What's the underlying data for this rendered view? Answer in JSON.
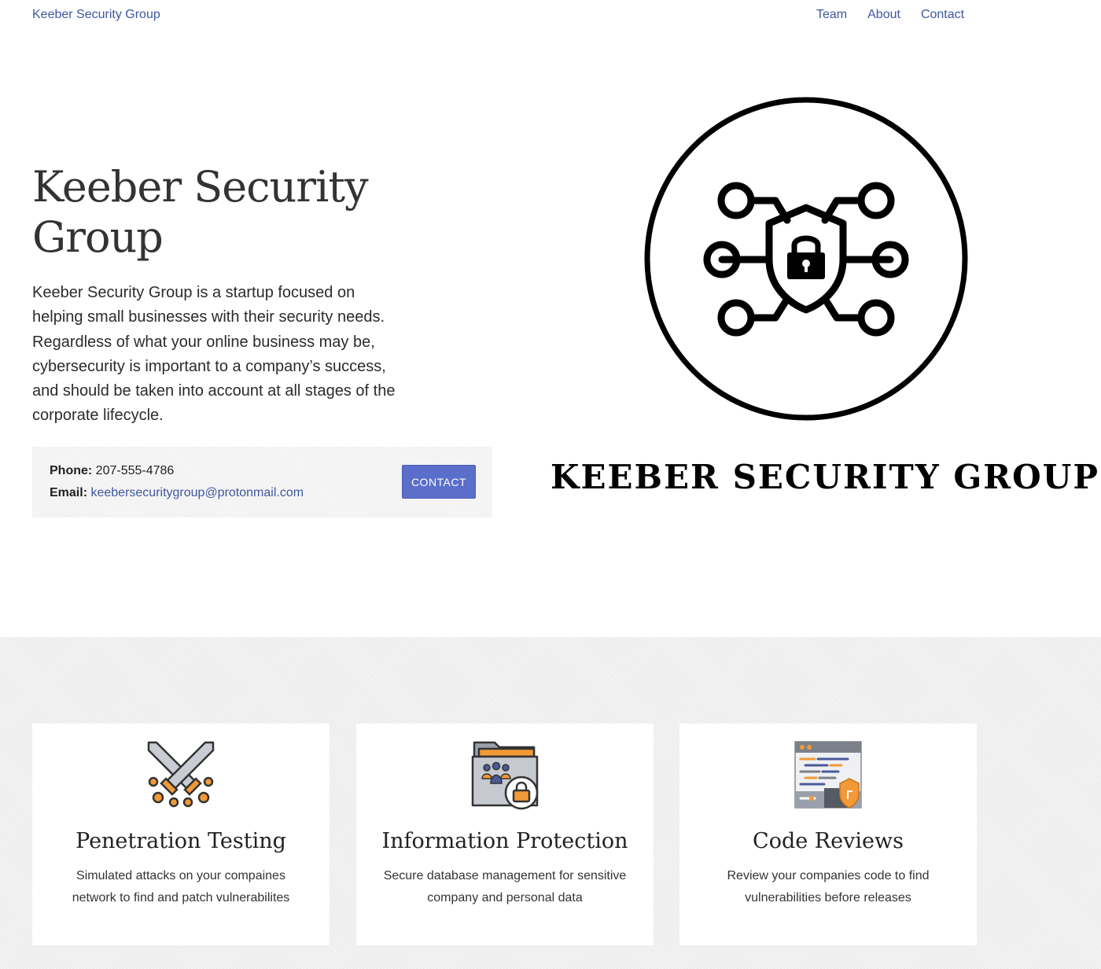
{
  "nav": {
    "brand": "Keeber Security Group",
    "links": [
      "Team",
      "About",
      "Contact"
    ]
  },
  "hero": {
    "title": "Keeber Security Group",
    "description": "Keeber Security Group is a startup focused on helping small businesses with their security needs. Regardless of what your online business may be, cybersecurity is important to a company’s success, and should be taken into account at all stages of the corporate lifecycle.",
    "phone_label": "Phone:",
    "phone": "207-555-4786",
    "email_label": "Email:",
    "email": "keebersecuritygroup@protonmail.com",
    "contact_button": "CONTACT",
    "logo_wordmark": "KEEBER SECURITY GROUP"
  },
  "services": [
    {
      "icon": "crossed-swords-icon",
      "title": "Penetration Testing",
      "description": "Simulated attacks on your compaines network to find and patch vulnerabilites"
    },
    {
      "icon": "locked-folder-icon",
      "title": "Information Protection",
      "description": "Secure database management for sensitive company and personal data"
    },
    {
      "icon": "code-shield-icon",
      "title": "Code Reviews",
      "description": "Review your companies code to find vulnerabilities before releases"
    }
  ],
  "colors": {
    "link": "#3f57a0",
    "button": "#5b6ec9",
    "accent_orange": "#f29a38"
  }
}
